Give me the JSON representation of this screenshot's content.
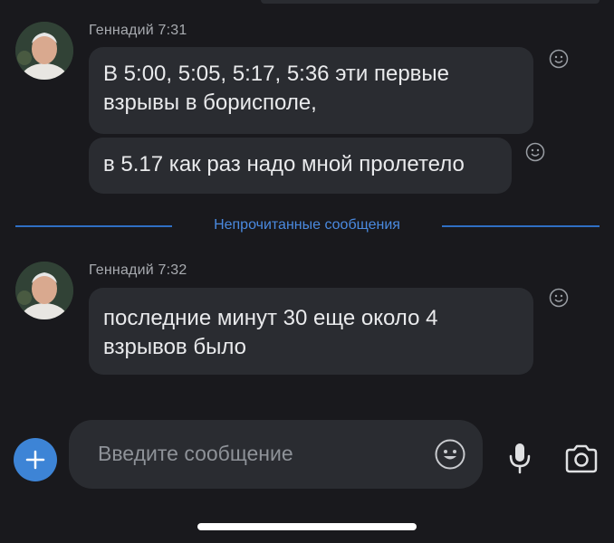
{
  "messages": [
    {
      "sender": "Геннадий",
      "time": "7:31",
      "bubbles": [
        {
          "lines": [
            "В 5:00, 5:05, 5:17, 5:36 эти первые",
            "взрывы в борисполе,"
          ]
        },
        {
          "lines": [
            "в 5.17 как раз надо мной пролетело"
          ]
        }
      ]
    },
    {
      "sender": "Геннадий",
      "time": "7:32",
      "bubbles": [
        {
          "lines": [
            "последние минут 30 еще около 4",
            "взрывов было"
          ]
        }
      ]
    }
  ],
  "unread_divider": "Непрочитанные сообщения",
  "composer": {
    "placeholder": "Введите сообщение"
  },
  "icons": {
    "add": "plus-icon",
    "emoji": "smiley-icon",
    "mic": "microphone-icon",
    "camera": "camera-icon",
    "reaction": "smiley-outline-icon"
  },
  "colors": {
    "background": "#19191d",
    "bubble": "#2a2c31",
    "accent": "#3d84d6",
    "divider": "#2f6fc4"
  }
}
